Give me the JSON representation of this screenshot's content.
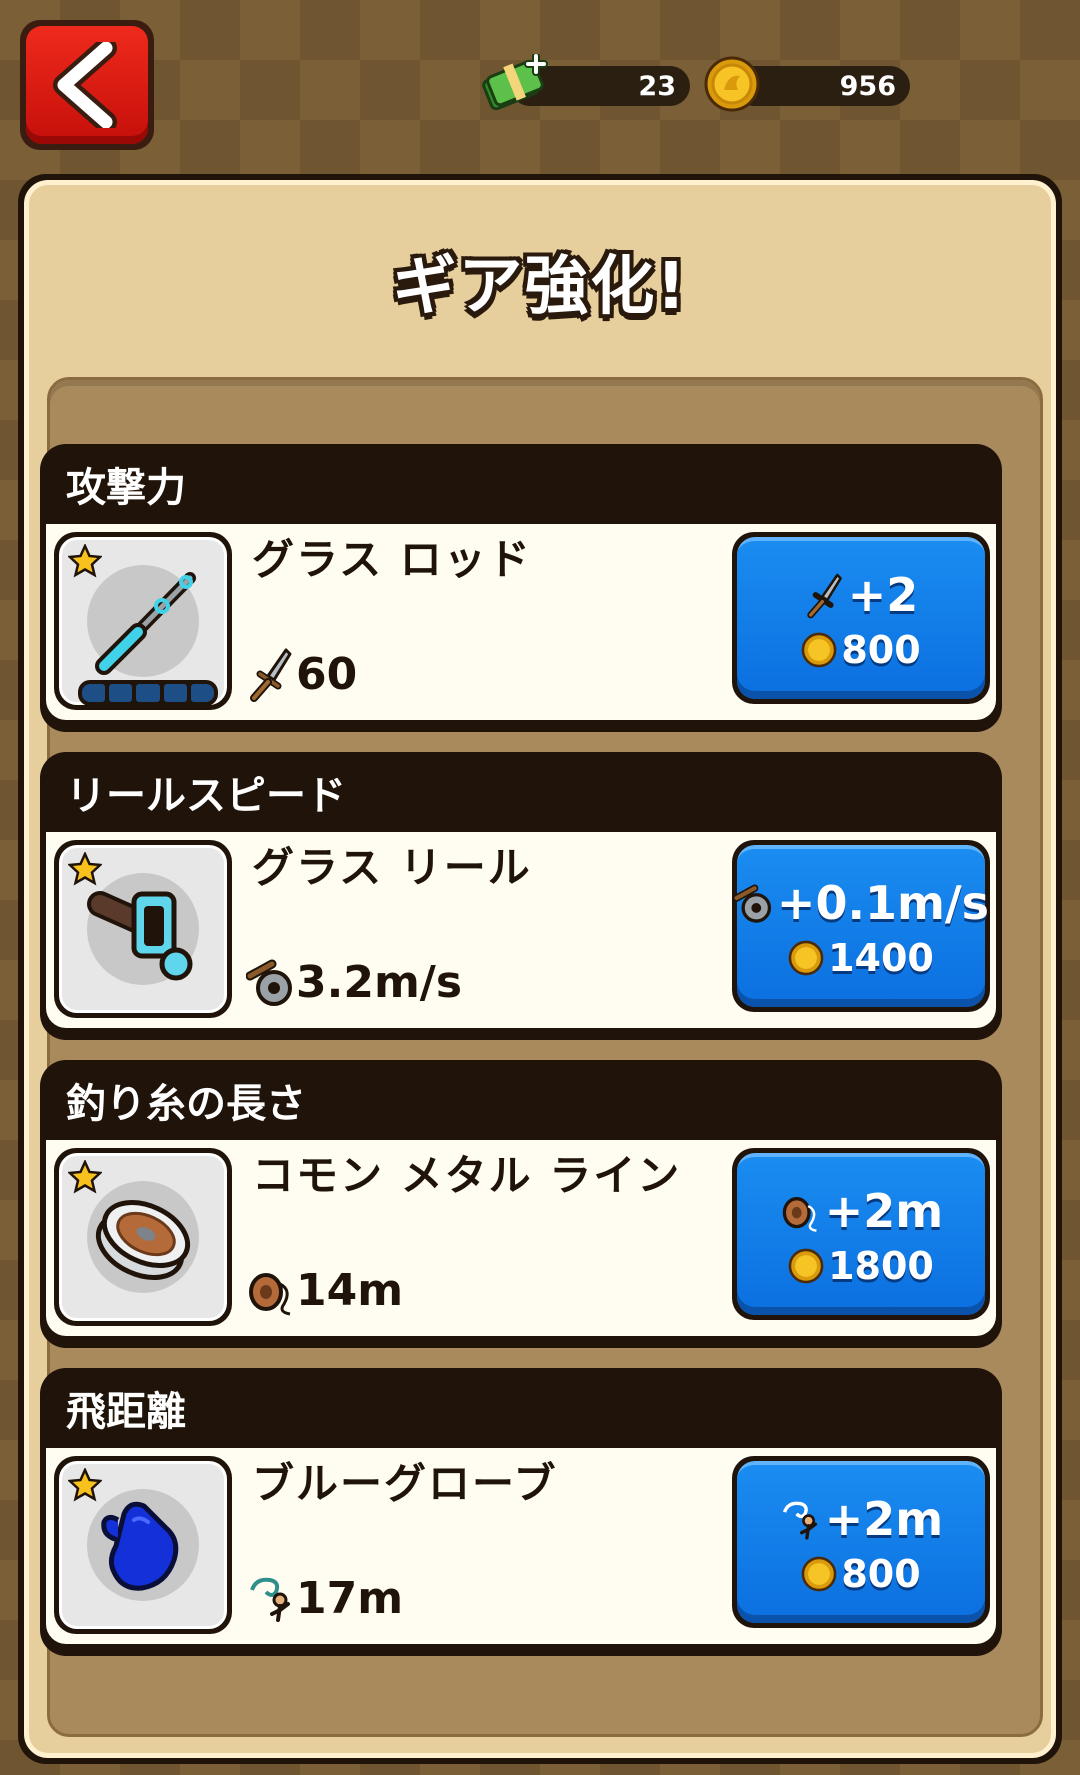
{
  "header": {
    "back_icon": "chevron-left-icon",
    "cash": {
      "icon": "cash-plus-icon",
      "value": "23"
    },
    "gold": {
      "icon": "gold-coin-icon",
      "value": "956"
    }
  },
  "panel": {
    "title": "ギア強化!",
    "cards": [
      {
        "category": "攻撃力",
        "item_name": "グラス ロッド",
        "item_icon": "glass-rod-icon",
        "stat_icon": "sword-icon",
        "stat_value": "60",
        "upgrade_effect": "+2",
        "upgrade_cost": "800"
      },
      {
        "category": "リールスピード",
        "item_name": "グラス リール",
        "item_icon": "glass-reel-icon",
        "stat_icon": "reel-speed-icon",
        "stat_value": "3.2m/s",
        "upgrade_effect": "+0.1m/s",
        "upgrade_cost": "1400"
      },
      {
        "category": "釣り糸の長さ",
        "item_name": "コモン メタル ライン",
        "item_icon": "metal-line-spool-icon",
        "stat_icon": "line-spool-icon",
        "stat_value": "14m",
        "upgrade_effect": "+2m",
        "upgrade_cost": "1800"
      },
      {
        "category": "飛距離",
        "item_name": "ブルーグローブ",
        "item_icon": "blue-glove-icon",
        "stat_icon": "cast-distance-icon",
        "stat_value": "17m",
        "upgrade_effect": "+2m",
        "upgrade_cost": "800"
      }
    ]
  },
  "colors": {
    "accent_blue": "#0b6fe0",
    "back_red": "#e01e14",
    "panel_bg": "#e6cf9c",
    "card_dark": "#1f130a"
  }
}
